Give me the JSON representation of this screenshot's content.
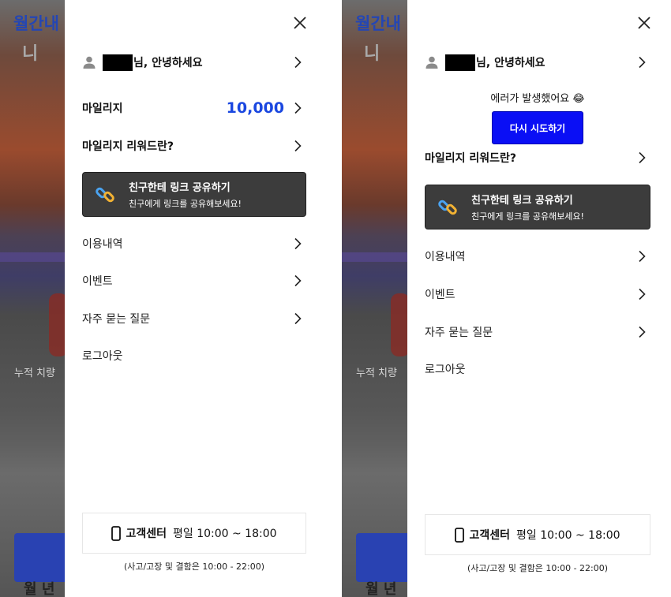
{
  "background": {
    "title": "월간내",
    "subtitle": "니",
    "caption": "누적 치량",
    "bottom_text": "월 년"
  },
  "drawer": {
    "greeting_suffix": "님, 안녕하세요",
    "mileage_label": "마일리지",
    "mileage_value": "10,000",
    "error_text": "에러가 발생했어요 😂",
    "retry_label": "다시 시도하기",
    "reward_label": "마일리지 리워드란?",
    "share_title": "친구한테 링크 공유하기",
    "share_subtitle": "친구에게 링크를 공유해보세요!",
    "menu": {
      "history": "이용내역",
      "events": "이벤트",
      "faq": "자주 묻는 질문",
      "logout": "로그아웃"
    },
    "customer_center": {
      "title": "고객센터",
      "hours": "평일 10:00 ~ 18:00",
      "note": "(사고/고장 및 결함은 10:00 - 22:00)"
    }
  },
  "colors": {
    "accent_blue": "#1a47e0",
    "retry_button": "#0a0ff5",
    "share_card": "#3c3c3c"
  },
  "icons": [
    "close-icon",
    "user-icon",
    "chevron-right-icon",
    "link-icon",
    "phone-icon"
  ]
}
